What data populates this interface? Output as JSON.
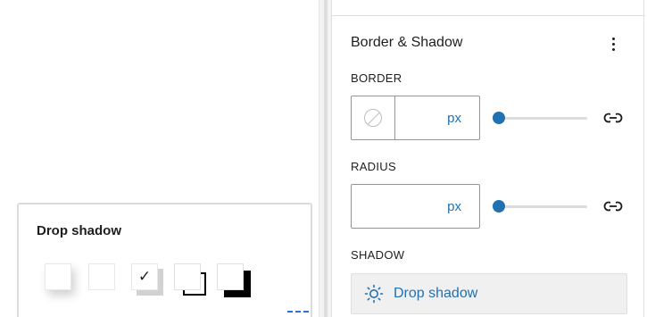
{
  "popover": {
    "title": "Drop shadow",
    "presets": [
      {
        "name": "natural",
        "selected": false
      },
      {
        "name": "none",
        "selected": false
      },
      {
        "name": "soft",
        "selected": true,
        "check": "✓"
      },
      {
        "name": "outlined",
        "selected": false
      },
      {
        "name": "sharp",
        "selected": false
      }
    ]
  },
  "panel": {
    "title": "Border & Shadow",
    "more_icon": "more-vertical-icon",
    "border": {
      "label": "BORDER",
      "value": "",
      "unit": "px",
      "slider_value": 0
    },
    "radius": {
      "label": "RADIUS",
      "value": "",
      "unit": "px",
      "slider_value": 0
    },
    "shadow": {
      "label": "SHADOW",
      "button_label": "Drop shadow",
      "icon": "sun-icon"
    }
  },
  "colors": {
    "accent": "#2271b1",
    "text": "#1e1e1e",
    "border": "#949494"
  }
}
